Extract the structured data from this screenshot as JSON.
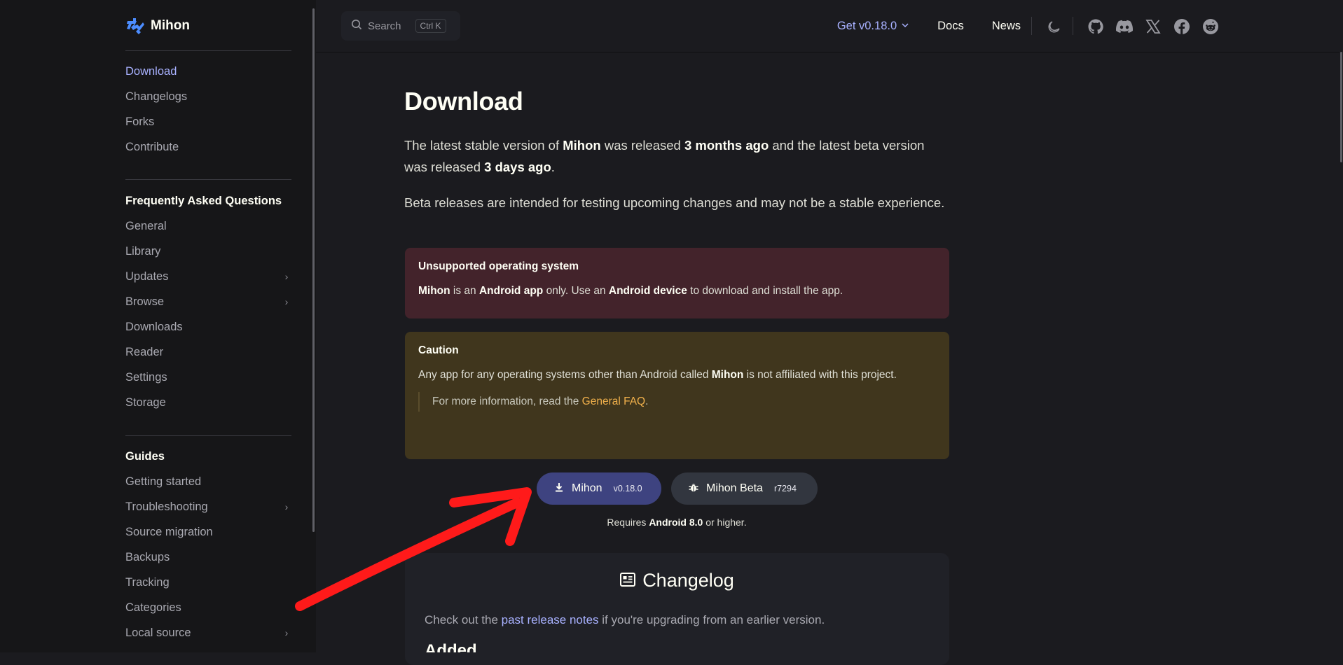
{
  "brand": {
    "name": "Mihon"
  },
  "sidebar": {
    "top_items": [
      {
        "label": "Download",
        "active": true
      },
      {
        "label": "Changelogs"
      },
      {
        "label": "Forks"
      },
      {
        "label": "Contribute"
      }
    ],
    "faq": {
      "heading": "Frequently Asked Questions",
      "items": [
        {
          "label": "General"
        },
        {
          "label": "Library"
        },
        {
          "label": "Updates",
          "expandable": true
        },
        {
          "label": "Browse",
          "expandable": true
        },
        {
          "label": "Downloads"
        },
        {
          "label": "Reader"
        },
        {
          "label": "Settings"
        },
        {
          "label": "Storage"
        }
      ]
    },
    "guides": {
      "heading": "Guides",
      "items": [
        {
          "label": "Getting started"
        },
        {
          "label": "Troubleshooting",
          "expandable": true
        },
        {
          "label": "Source migration"
        },
        {
          "label": "Backups"
        },
        {
          "label": "Tracking"
        },
        {
          "label": "Categories"
        },
        {
          "label": "Local source",
          "expandable": true
        }
      ]
    }
  },
  "topnav": {
    "search_label": "Search",
    "search_kbd": "Ctrl K",
    "get_label": "Get v0.18.0",
    "docs_label": "Docs",
    "news_label": "News",
    "icons": [
      "moon-icon",
      "github-icon",
      "discord-icon",
      "x-icon",
      "facebook-icon",
      "reddit-icon"
    ]
  },
  "main": {
    "title": "Download",
    "intro": {
      "t1": "The latest stable version of ",
      "b1": "Mihon",
      "t2": " was released ",
      "b2": "3 months ago",
      "t3": " and the latest beta version was released ",
      "b3": "3 days ago",
      "t4": "."
    },
    "beta_note": "Beta releases are intended for testing upcoming changes and may not be a stable experience.",
    "danger": {
      "title": "Unsupported operating system",
      "b1": "Mihon",
      "t1": " is an ",
      "b2": "Android app",
      "t2": " only. Use an ",
      "b3": "Android device",
      "t3": " to download and install the app."
    },
    "caution": {
      "title": "Caution",
      "t1": "Any app for any operating systems other than Android called ",
      "b1": "Mihon",
      "t2": " is not affiliated with this project.",
      "q1": "For more information, read the ",
      "link": "General FAQ",
      "q2": "."
    },
    "buttons": {
      "stable_label": "Mihon",
      "stable_version": "v0.18.0",
      "beta_label": "Mihon Beta",
      "beta_version": "r7294"
    },
    "requirement": {
      "t1": "Requires ",
      "b1": "Android 8.0",
      "t2": " or higher."
    },
    "changelog": {
      "title": "Changelog",
      "t1": "Check out the ",
      "link": "past release notes",
      "t2": " if you're upgrading from an earlier version.",
      "subheading": "Added"
    }
  },
  "colors": {
    "accent": "#a8b1ff",
    "annotation_arrow": "#ff1a1a",
    "danger_bg": "#43232b",
    "warning_bg": "#40361d",
    "primary_btn": "#3e4380"
  }
}
